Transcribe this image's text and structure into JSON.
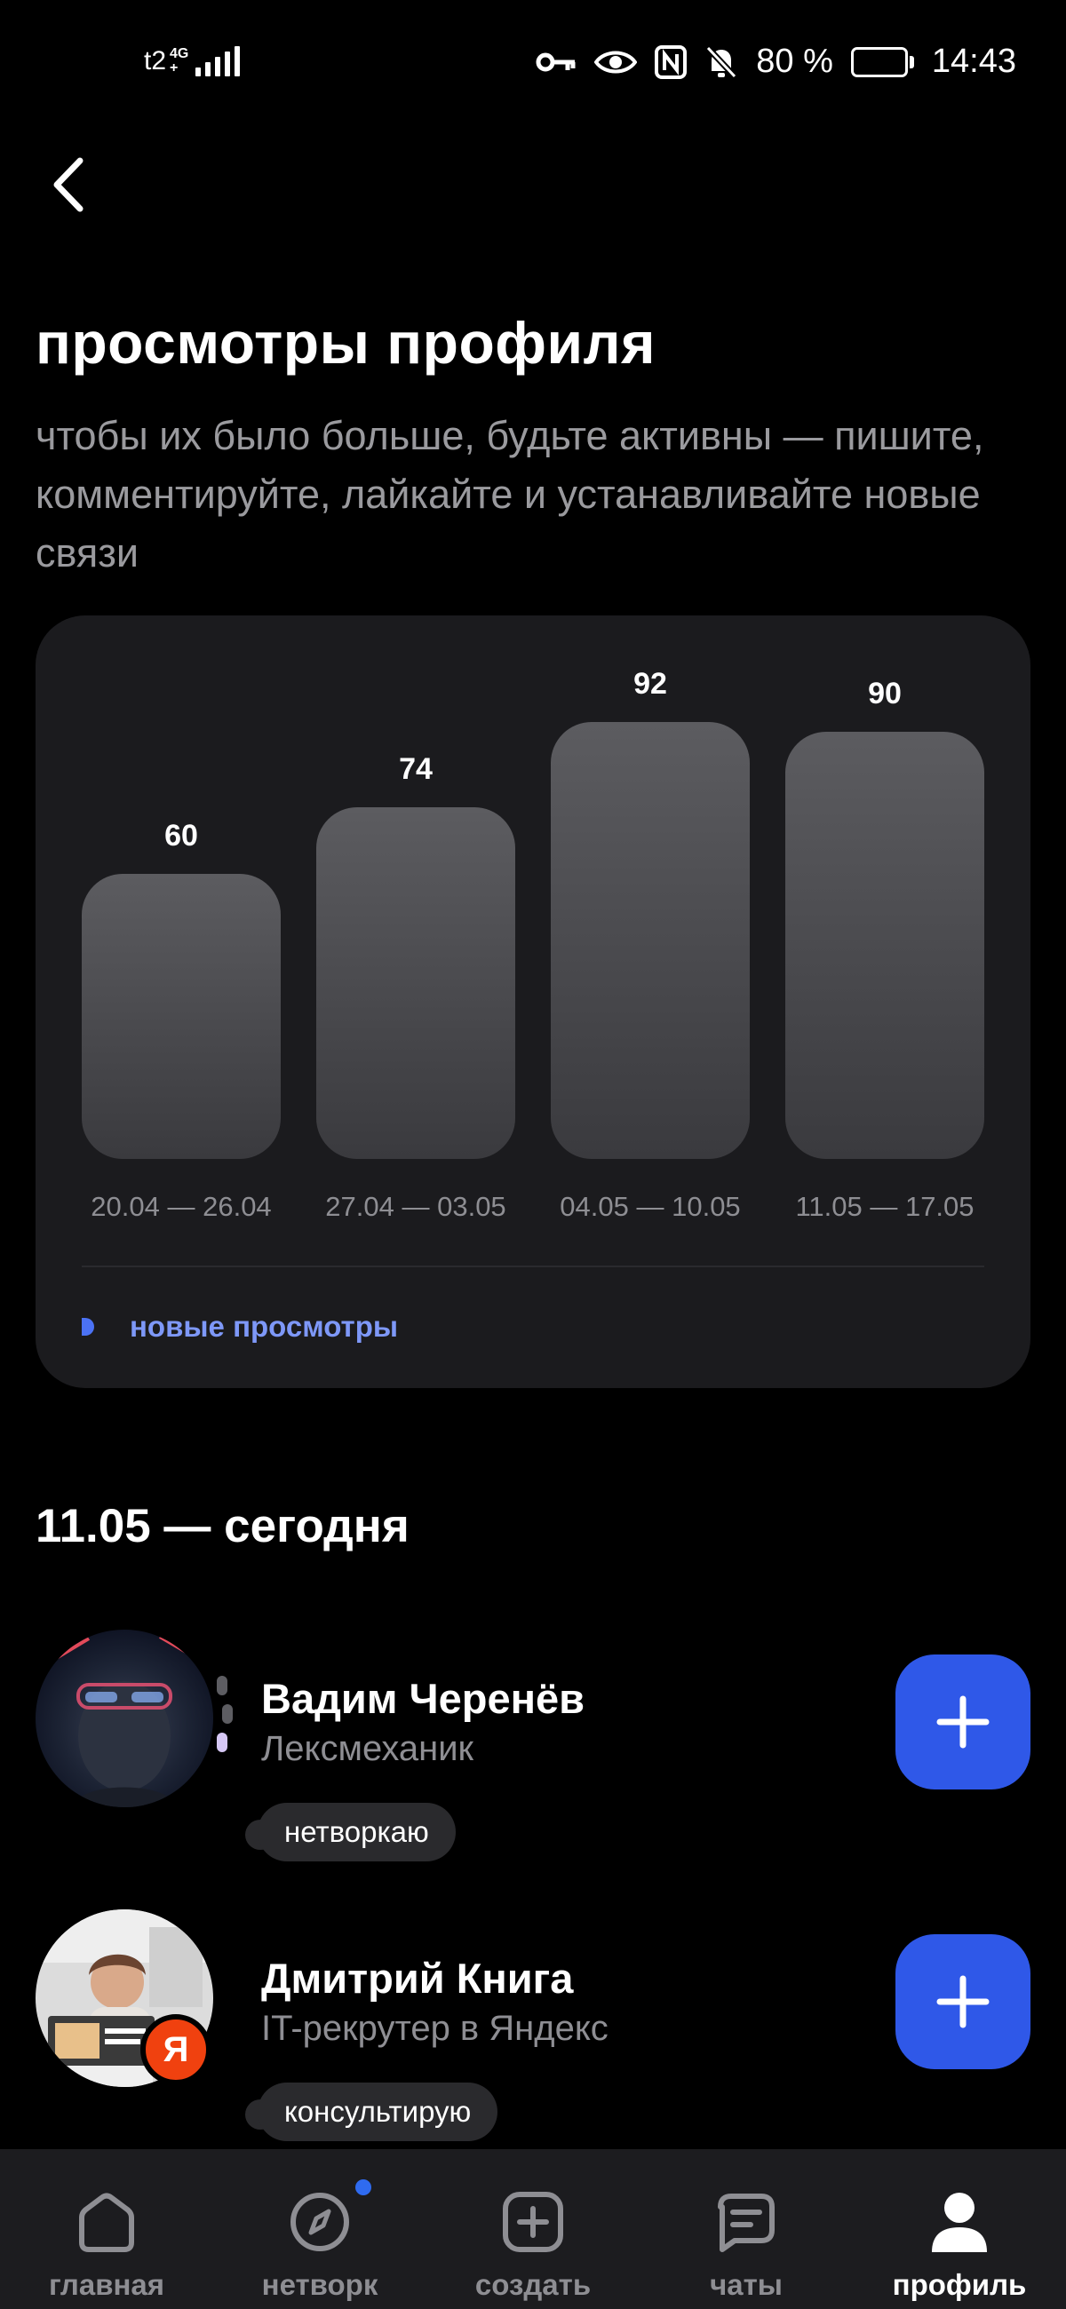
{
  "status_bar": {
    "carrier": "t2",
    "network": "4G",
    "network_sub": "+",
    "battery": "80 %",
    "battery_level": 0.8,
    "time": "14:43"
  },
  "header": {
    "title": "просмотры профиля",
    "subtitle": "чтобы их было больше, будьте активны — пишите, комментируйте, лайкайте и устанавливайте новые связи"
  },
  "chart_data": {
    "type": "bar",
    "categories": [
      "20.04 — 26.04",
      "27.04 — 03.05",
      "04.05 — 10.05",
      "11.05 — 17.05"
    ],
    "series": [
      {
        "name": "новые просмотры",
        "values": [
          60,
          74,
          92,
          90
        ]
      }
    ],
    "legend": "bottom-left",
    "grid": false,
    "colors": {
      "bar": "#4a4a4e",
      "legend": "#4b72f5"
    }
  },
  "section": {
    "title": "11.05 — сегодня"
  },
  "people": [
    {
      "name": "Вадим Черенёв",
      "role": "Лексмеханик",
      "status": "нетворкаю"
    },
    {
      "name": "Дмитрий Книга",
      "role": "IT-рекрутер в Яндекс",
      "status": "консультирую",
      "badge": "Я"
    }
  ],
  "nav": {
    "items": [
      {
        "label": "главная",
        "icon": "home-icon"
      },
      {
        "label": "нетворк",
        "icon": "compass-icon"
      },
      {
        "label": "создать",
        "icon": "create-icon"
      },
      {
        "label": "чаты",
        "icon": "chat-icon"
      },
      {
        "label": "профиль",
        "icon": "profile-icon"
      }
    ],
    "active": "профиль"
  },
  "colors": {
    "accent": "#2f58e8",
    "background": "#000000",
    "card": "#1b1b1e"
  }
}
